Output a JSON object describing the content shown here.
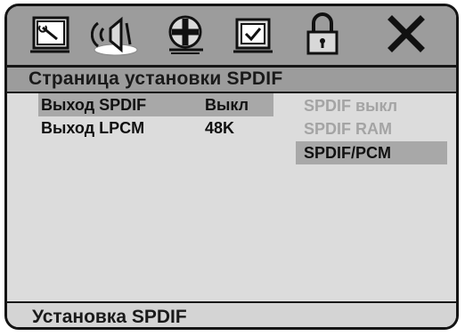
{
  "toolbar": {
    "icons": [
      "general-setup-tv-wrench-icon",
      "audio-speaker-icon",
      "video-reel-icon",
      "preference-tv-checkmark-icon",
      "password-padlock-icon",
      "exit-x-icon"
    ],
    "active_icon": "audio-speaker-icon"
  },
  "page": {
    "title": "Страница установки SPDIF"
  },
  "settings": [
    {
      "name": "Выход SPDIF",
      "value": "Выкл"
    },
    {
      "name": "Выход LPCM",
      "value": "48K"
    }
  ],
  "options": [
    {
      "label": "SPDIF выкл",
      "selected": false
    },
    {
      "label": "SPDIF RAM",
      "selected": false
    },
    {
      "label": "SPDIF/PCM",
      "selected": true
    }
  ],
  "footer": {
    "text": "Установка SPDIF"
  },
  "colors": {
    "panel": "#d4d4d4",
    "bars": "#9c9c9c",
    "highlight": "#a8a8a8",
    "disabled_text": "#a4a4a4",
    "border": "#141414"
  }
}
